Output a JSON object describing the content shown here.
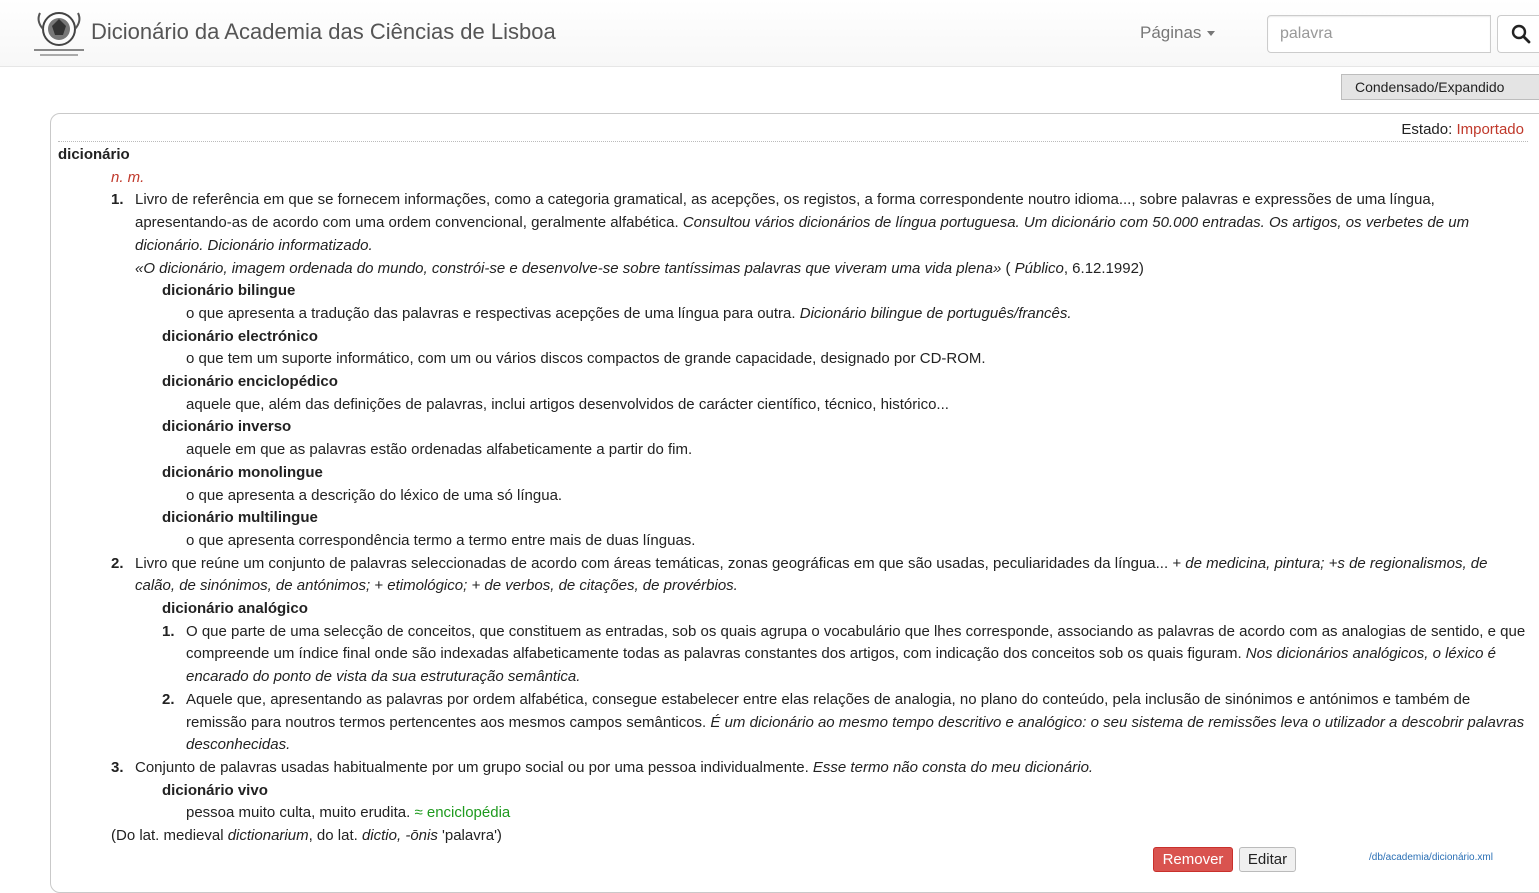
{
  "navbar": {
    "brand": "Dicionário da Academia das Ciências de Lisboa",
    "pages_label": "Páginas",
    "search_placeholder": "palavra",
    "toggle_label": "Condensado/Expandido"
  },
  "status": {
    "label": "Estado:",
    "value": "Importado"
  },
  "entry": {
    "headword": "dicionário",
    "pos": "n. m.",
    "senses": [
      {
        "num": "1.",
        "def": "Livro de referência em que se fornecem informações, como a categoria gramatical, as acepções, os registos, a forma correspondente noutro idioma..., sobre palavras e expressões de uma língua, apresentando-as de acordo com uma ordem convencional, geralmente alfabética. ",
        "example": "Consultou vários dicionários de língua portuguesa. Um dicionário com 50.000 entradas. Os artigos, os verbetes de um dicionário. Dicionário informatizado.",
        "quote": "«O dicionário, imagem ordenada do mundo, constrói-se e desenvolve-se sobre tantíssimas palavras que viveram uma vida plena»",
        "quote_src_open": " ( ",
        "quote_src": "Público",
        "quote_src_close": ", 6.12.1992)",
        "subs": [
          {
            "term": "dicionário bilingue",
            "def": "o que apresenta a tradução das palavras e respectivas acepções de uma língua para outra. ",
            "example": "Dicionário bilingue de português/francês."
          },
          {
            "term": "dicionário electrónico",
            "def": "o que tem um suporte informático, com um ou vários discos compactos de grande capacidade, designado por CD-ROM."
          },
          {
            "term": "dicionário enciclopédico",
            "def": "aquele que, além das definições de palavras, inclui artigos desenvolvidos de carácter científico, técnico, histórico..."
          },
          {
            "term": "dicionário inverso",
            "def": "aquele em que as palavras estão ordenadas alfabeticamente a partir do fim."
          },
          {
            "term": "dicionário monolingue",
            "def": "o que apresenta a descrição do léxico de uma só língua."
          },
          {
            "term": "dicionário multilingue",
            "def": "o que apresenta correspondência termo a termo entre mais de duas línguas."
          }
        ]
      },
      {
        "num": "2.",
        "def": "Livro que reúne um conjunto de palavras seleccionadas de acordo com áreas temáticas, zonas geográficas em que são usadas, peculiaridades da língua... ",
        "example": "+ de medicina, pintura; +s de regionalismos, de calão, de sinónimos, de antónimos; + etimológico; + de verbos, de citações, de provérbios.",
        "sub_term": "dicionário analógico",
        "subsenses": [
          {
            "num": "1.",
            "def": "O que parte de uma selecção de conceitos, que constituem as entradas, sob os quais agrupa o vocabulário que lhes corresponde, associando as palavras de acordo com as analogias de sentido, e que compreende um índice final onde são indexadas alfabeticamente todas as palavras constantes dos artigos, com indicação dos conceitos sob os quais figuram. ",
            "example": "Nos dicionários analógicos, o léxico é encarado do ponto de vista da sua estruturação semântica."
          },
          {
            "num": "2.",
            "def": "Aquele que, apresentando as palavras por ordem alfabética, consegue estabelecer entre elas relações de analogia, no plano do conteúdo, pela inclusão de sinónimos e antónimos e também de remissão para noutros termos pertencentes aos mesmos campos semânticos. ",
            "example": "É um dicionário ao mesmo tempo descritivo e analógico: o seu sistema de remissões leva o utilizador a descobrir palavras desconhecidas."
          }
        ]
      },
      {
        "num": "3.",
        "def": "Conjunto de palavras usadas habitualmente por um grupo social ou por uma pessoa individualmente. ",
        "example": "Esse termo não consta do meu dicionário.",
        "sub_term": "dicionário vivo",
        "sub_def": "pessoa muito culta, muito erudita. ",
        "synonym": "≈ enciclopédia"
      }
    ],
    "etym": {
      "p1": "(Do lat. medieval ",
      "w1": "dictionarium",
      "p2": ", do lat. ",
      "w2": "dictio, -ōnis",
      "p3": " 'palavra')"
    }
  },
  "actions": {
    "remove": "Remover",
    "edit": "Editar",
    "path": "/db/academia/dicionário.xml"
  },
  "colors": {
    "status": "#c0392b",
    "remove_button": "#d9534f",
    "synonym": "#1e9a1e",
    "link": "#2a6fb5"
  }
}
